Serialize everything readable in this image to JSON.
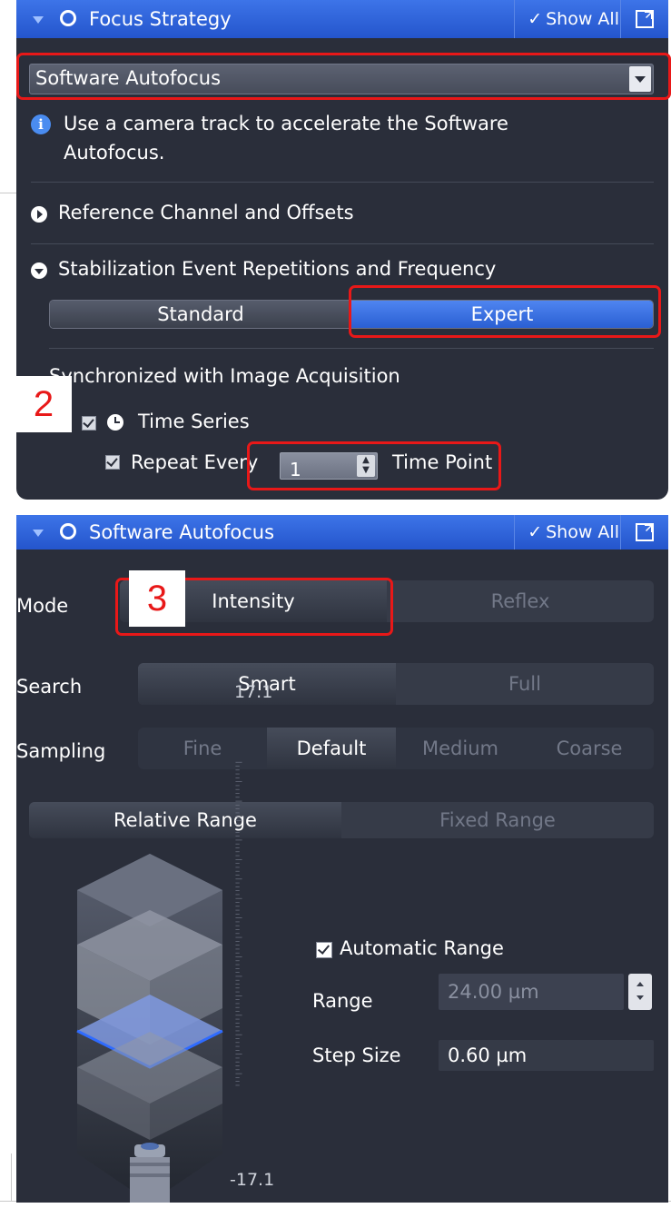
{
  "focus_strategy": {
    "title": "Focus Strategy",
    "show_all_label": "Show All",
    "method_select": "Software Autofocus",
    "info_text": "Use a camera track to accelerate the Software Autofocus.",
    "section_reference": "Reference Channel and Offsets",
    "section_stabilization": "Stabilization Event Repetitions and Frequency",
    "modes": [
      "Standard",
      "Expert"
    ],
    "selected_mode": "Expert",
    "sync_heading": "Synchronized with Image Acquisition",
    "time_series_label": "Time Series",
    "repeat_every_label": "Repeat Every",
    "repeat_every_value": "1",
    "time_point_label": "Time Point"
  },
  "software_autofocus": {
    "title": "Software Autofocus",
    "show_all_label": "Show All",
    "mode_label": "Mode",
    "mode_options": [
      "Intensity",
      "Reflex"
    ],
    "mode_selected": "Intensity",
    "search_label": "Search",
    "search_options": [
      "Smart",
      "Full"
    ],
    "search_selected": "Smart",
    "sampling_label": "Sampling",
    "sampling_options": [
      "Fine",
      "Default",
      "Medium",
      "Coarse"
    ],
    "sampling_selected": "Default",
    "range_type_options": [
      "Relative Range",
      "Fixed Range"
    ],
    "range_type_selected": "Relative Range",
    "scale_top": "17.1",
    "scale_bottom": "-17.1",
    "automatic_range_label": "Automatic Range",
    "range_label": "Range",
    "range_value": "24.00 µm",
    "step_size_label": "Step Size",
    "step_size_value": "0.60 µm"
  },
  "annotations": {
    "badge_2": "2",
    "badge_3": "3",
    "highlight_color": "#e81818"
  },
  "colors": {
    "panel_bg": "#2a2e3a",
    "titlebar_blue": "#3d74e8",
    "selected_blue": "#2a5fd3"
  }
}
